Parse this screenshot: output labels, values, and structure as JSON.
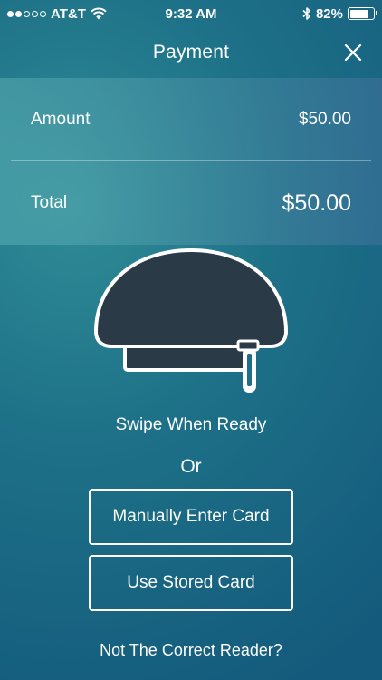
{
  "status_bar": {
    "carrier": "AT&T",
    "time": "9:32 AM",
    "battery_percent": "82%",
    "battery_level": 0.82,
    "signal_bars_filled": 2,
    "signal_bars_total": 5
  },
  "nav": {
    "title": "Payment",
    "close_icon": "close-icon"
  },
  "summary": {
    "amount_label": "Amount",
    "amount_value": "$50.00",
    "total_label": "Total",
    "total_value": "$50.00"
  },
  "reader": {
    "icon": "card-reader-icon",
    "instruction": "Swipe When Ready",
    "or_text": "Or"
  },
  "actions": {
    "manual_label": "Manually Enter Card",
    "stored_label": "Use Stored Card",
    "wrong_reader_label": "Not The Correct Reader?"
  },
  "colors": {
    "reader_fill": "#2a3a47",
    "outline": "#ffffff"
  }
}
